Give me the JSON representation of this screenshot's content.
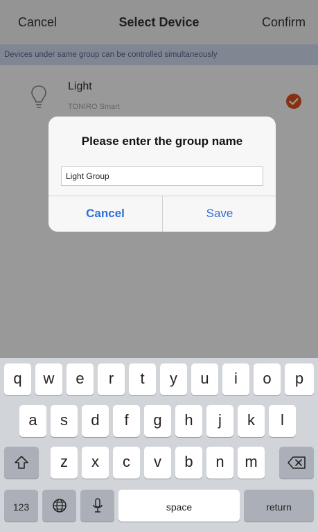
{
  "nav": {
    "cancel": "Cancel",
    "title": "Select Device",
    "confirm": "Confirm"
  },
  "notice": "Devices under same group can be controlled simultaneously",
  "device": {
    "name": "Light",
    "subtitle": "TONIRO Smart",
    "selected": true
  },
  "dialog": {
    "title": "Please enter the group name",
    "input_value": "Light Group",
    "cancel": "Cancel",
    "save": "Save"
  },
  "keyboard": {
    "row1": [
      "q",
      "w",
      "e",
      "r",
      "t",
      "y",
      "u",
      "i",
      "o",
      "p"
    ],
    "row2": [
      "a",
      "s",
      "d",
      "f",
      "g",
      "h",
      "j",
      "k",
      "l"
    ],
    "row3": [
      "z",
      "x",
      "c",
      "v",
      "b",
      "n",
      "m"
    ],
    "numbers": "123",
    "space": "space",
    "return": "return"
  },
  "colors": {
    "accent_blue": "#2f6fd8",
    "check_orange": "#e0541f",
    "notice_bg": "#d8e2f4"
  }
}
